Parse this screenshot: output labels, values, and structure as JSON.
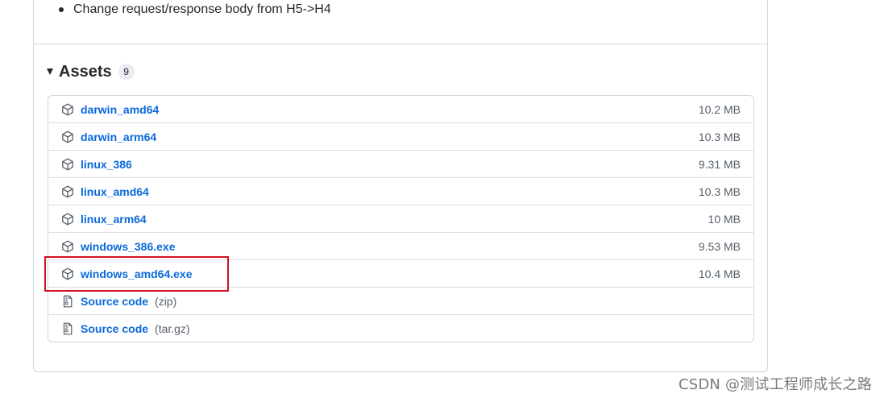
{
  "release_notes": {
    "items": [
      "Change request/response body from H5->H4"
    ]
  },
  "assets": {
    "title": "Assets",
    "count": "9",
    "files": [
      {
        "name": "darwin_amd64",
        "size": "10.2 MB",
        "icon": "package-icon"
      },
      {
        "name": "darwin_arm64",
        "size": "10.3 MB",
        "icon": "package-icon"
      },
      {
        "name": "linux_386",
        "size": "9.31 MB",
        "icon": "package-icon"
      },
      {
        "name": "linux_amd64",
        "size": "10.3 MB",
        "icon": "package-icon"
      },
      {
        "name": "linux_arm64",
        "size": "10 MB",
        "icon": "package-icon"
      },
      {
        "name": "windows_386.exe",
        "size": "9.53 MB",
        "icon": "package-icon"
      },
      {
        "name": "windows_amd64.exe",
        "size": "10.4 MB",
        "icon": "package-icon"
      },
      {
        "name": "Source code",
        "suffix": "(zip)",
        "icon": "file-zip-icon"
      },
      {
        "name": "Source code",
        "suffix": "(tar.gz)",
        "icon": "file-zip-icon"
      }
    ]
  },
  "highlight": {
    "color": "#d0111f",
    "target": "windows_amd64.exe"
  },
  "watermark": "CSDN @测试工程师成长之路",
  "colors": {
    "link": "#0969da",
    "muted": "#57606a",
    "border": "#d0d7de"
  }
}
